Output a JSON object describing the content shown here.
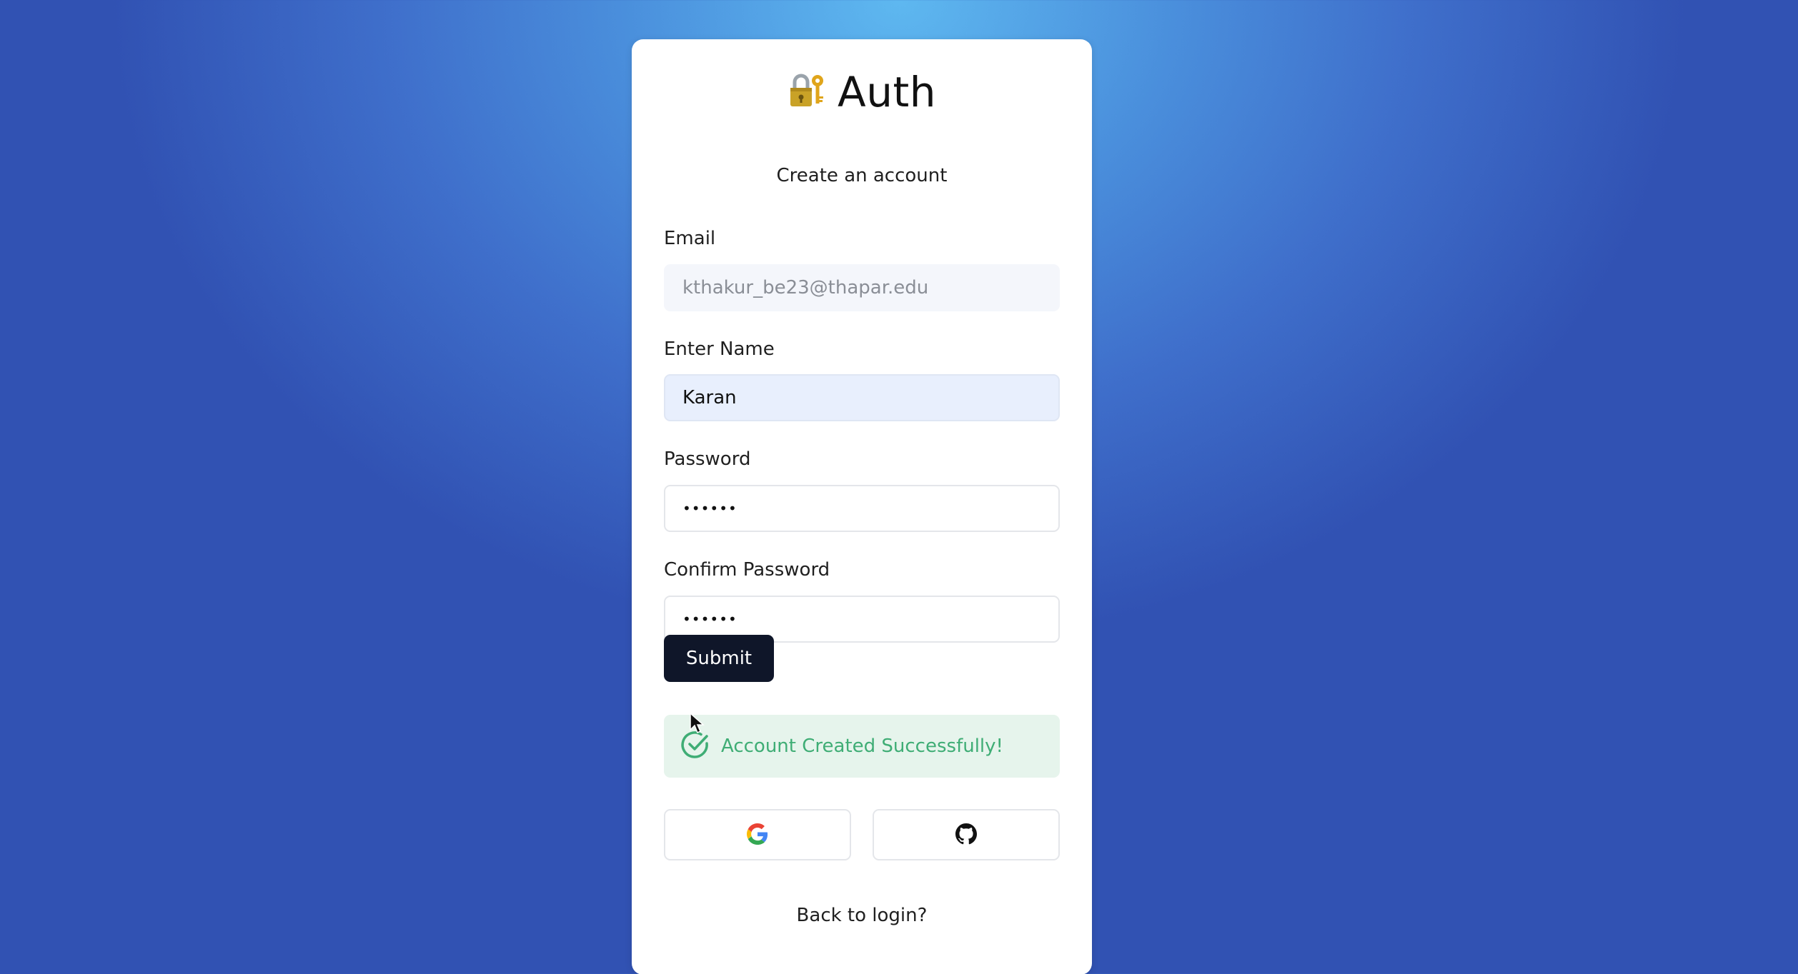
{
  "app": {
    "title": "Auth",
    "subtitle": "Create an account"
  },
  "form": {
    "email": {
      "label": "Email",
      "value": "kthakur_be23@thapar.edu"
    },
    "name": {
      "label": "Enter Name",
      "value": "Karan"
    },
    "password": {
      "label": "Password",
      "value": "••••••"
    },
    "confirm_password": {
      "label": "Confirm Password",
      "value": "••••••"
    },
    "submit_label": "Submit"
  },
  "alert": {
    "message": "Account Created Successfully!",
    "color": "#3fad75",
    "background": "#e6f4ec"
  },
  "oauth": {
    "providers": [
      {
        "name": "google",
        "icon": "google-icon"
      },
      {
        "name": "github",
        "icon": "github-icon"
      }
    ]
  },
  "footer": {
    "back_link": "Back to login?"
  },
  "icons": {
    "header": "lock-with-key-icon",
    "alert": "check-circle-icon"
  },
  "theme": {
    "primary_button": "#0f1629",
    "background_top": "#5eb8f0",
    "background_bottom": "#3152b3"
  }
}
